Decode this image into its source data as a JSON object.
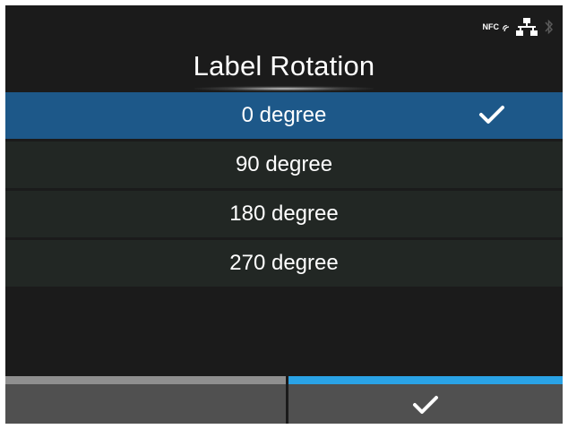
{
  "screen": {
    "title": "Label Rotation",
    "status": {
      "nfc_label": "NFC",
      "icons": [
        "nfc-icon",
        "network-icon",
        "bluetooth-icon"
      ]
    },
    "options": [
      {
        "label": "0 degree",
        "selected": true
      },
      {
        "label": "90 degree",
        "selected": false
      },
      {
        "label": "180 degree",
        "selected": false
      },
      {
        "label": "270 degree",
        "selected": false
      }
    ],
    "softkeys": {
      "left": {
        "icon": "none"
      },
      "right": {
        "icon": "check-icon"
      }
    },
    "colors": {
      "background": "#1b1b1b",
      "selected_row": "#1d5889",
      "row": "#222724",
      "softkey_accent": "#2aa3e6"
    }
  }
}
